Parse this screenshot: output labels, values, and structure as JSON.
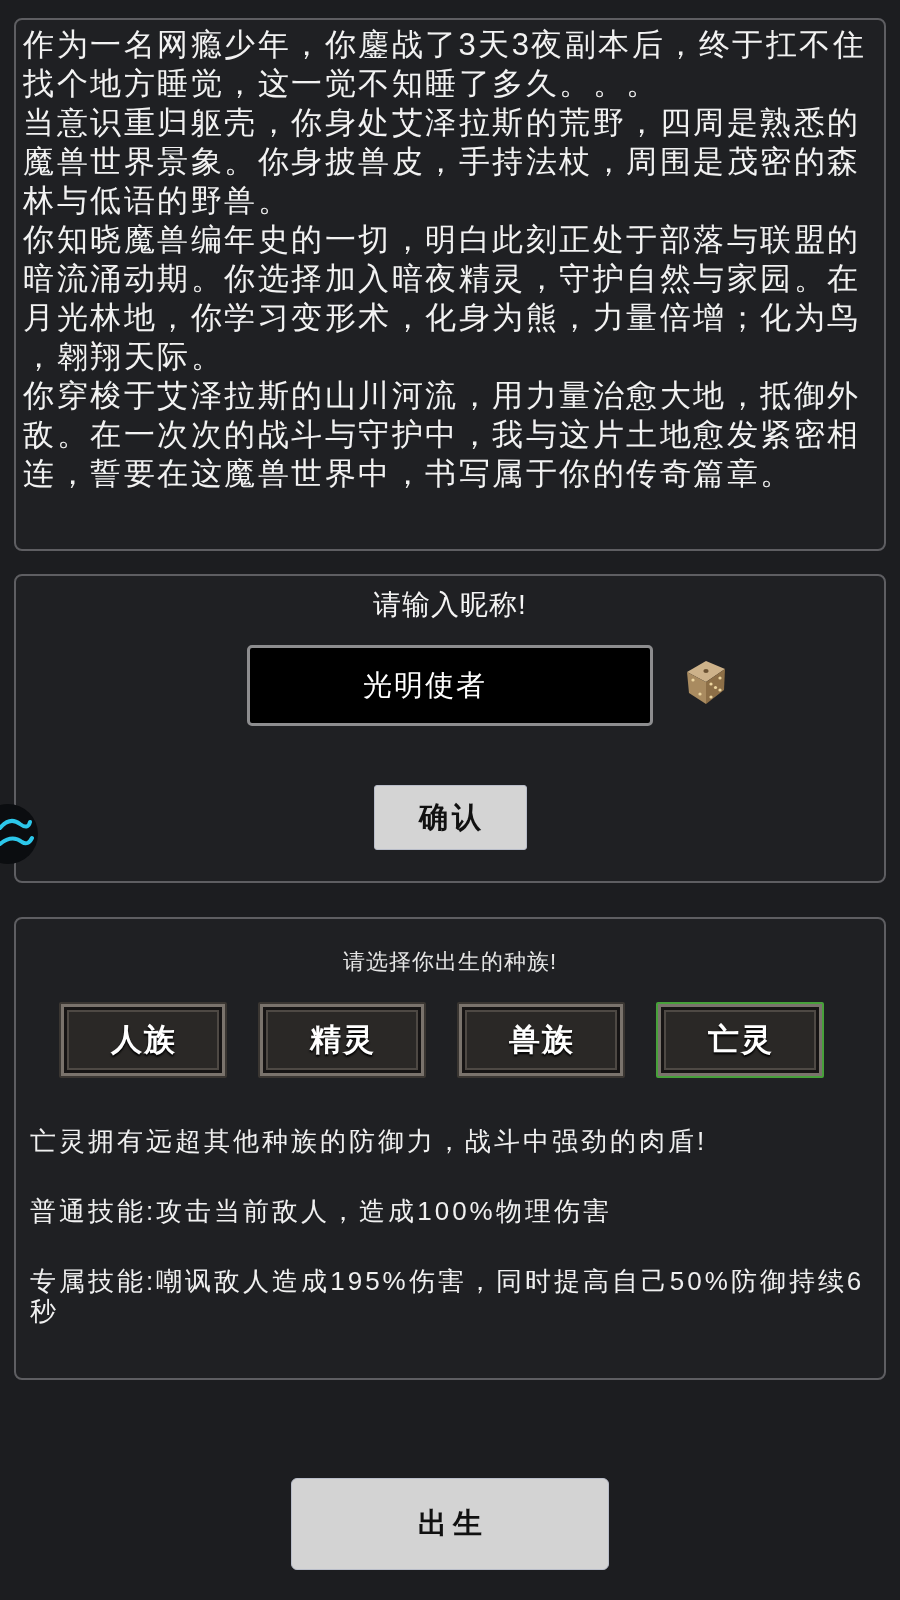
{
  "story": {
    "paragraphs": [
      "作为一名网瘾少年，你鏖战了3天3夜副本后，终于扛不住找个地方睡觉，这一觉不知睡了多久。。。",
      "当意识重归躯壳，你身处艾泽拉斯的荒野，四周是熟悉的魔兽世界景象。你身披兽皮，手持法杖，周围是茂密的森林与低语的野兽。",
      "你知晓魔兽编年史的一切，明白此刻正处于部落与联盟的暗流涌动期。你选择加入暗夜精灵，守护自然与家园。在月光林地，你学习变形术，化身为熊，力量倍增；化为鸟，翱翔天际。",
      "你穿梭于艾泽拉斯的山川河流，用力量治愈大地，抵御外敌。在一次次的战斗与守护中，我与这片土地愈发紧密相连，誓要在这魔兽世界中，书写属于你的传奇篇章。"
    ]
  },
  "nickname": {
    "title": "请输入昵称!",
    "value": "光明使者",
    "confirm_button": "确认"
  },
  "race": {
    "title": "请选择你出生的种族!",
    "options": [
      {
        "label": "人族",
        "selected": false
      },
      {
        "label": "精灵",
        "selected": false
      },
      {
        "label": "兽族",
        "selected": false
      },
      {
        "label": "亡灵",
        "selected": true
      }
    ],
    "description": "亡灵拥有远超其他种族的防御力，战斗中强劲的肉盾!",
    "skills": [
      "普通技能:攻击当前敌人，造成100%物理伤害",
      "专属技能:嘲讽敌人造成195%伤害，同时提高自己50%防御持续6秒"
    ]
  },
  "birth_button": "出生"
}
